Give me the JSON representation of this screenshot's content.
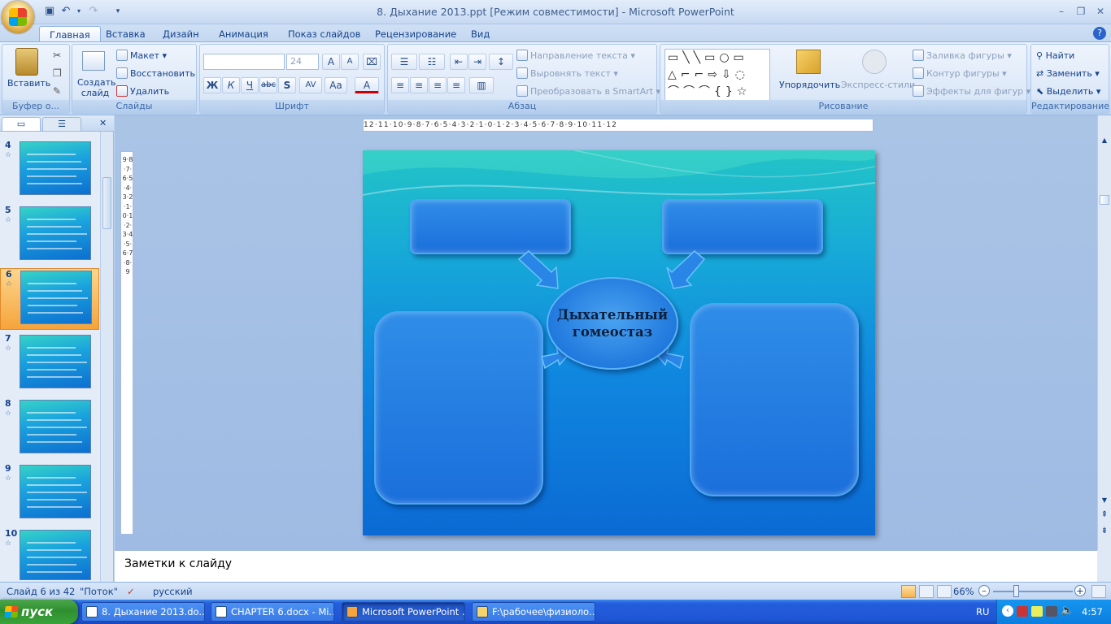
{
  "window": {
    "title": "8. Дыхание 2013.ppt [Режим совместимости] - Microsoft PowerPoint"
  },
  "tabs": [
    "Главная",
    "Вставка",
    "Дизайн",
    "Анимация",
    "Показ слайдов",
    "Рецензирование",
    "Вид"
  ],
  "ribbon": {
    "clipboard": {
      "paste": "Вставить",
      "label": "Буфер о..."
    },
    "slides": {
      "new_slide": "Создать слайд",
      "layout": "Макет",
      "reset": "Восстановить",
      "delete": "Удалить",
      "label": "Слайды"
    },
    "font": {
      "size": "24",
      "label": "Шрифт",
      "bold": "Ж",
      "italic": "К",
      "underline": "Ч",
      "strike": "abc",
      "shadow": "S",
      "spacing": "AV",
      "case": "Aa",
      "color": "A"
    },
    "paragraph": {
      "text_direction": "Направление текста",
      "align_text": "Выровнять текст",
      "smartart": "Преобразовать в SmartArt",
      "label": "Абзац"
    },
    "drawing": {
      "arrange": "Упорядочить",
      "quick_styles": "Экспресс-стили",
      "fill": "Заливка фигуры",
      "outline": "Контур фигуры",
      "effects": "Эффекты для фигур",
      "label": "Рисование"
    },
    "editing": {
      "find": "Найти",
      "replace": "Заменить",
      "select": "Выделить",
      "label": "Редактирование"
    }
  },
  "thumbnails": [
    {
      "num": "4",
      "selected": false
    },
    {
      "num": "5",
      "selected": false
    },
    {
      "num": "6",
      "selected": true
    },
    {
      "num": "7",
      "selected": false
    },
    {
      "num": "8",
      "selected": false
    },
    {
      "num": "9",
      "selected": false
    },
    {
      "num": "10",
      "selected": false
    }
  ],
  "ruler": {
    "horizontal": "12·11·10·9·8·7·6·5·4·3·2·1·0·1·2·3·4·5·6·7·8·9·10·11·12",
    "vertical": "9·8·7·6·5·4·3·2·1·0·1·2·3·4·5·6·7·8·9"
  },
  "slide": {
    "center_text_line1": "Дыхательный",
    "center_text_line2": "гомеостаз"
  },
  "notes": {
    "placeholder": "Заметки к слайду"
  },
  "status": {
    "slide_info": "Слайд 6 из 42",
    "theme": "\"Поток\"",
    "language": "русский",
    "zoom": "66%"
  },
  "taskbar": {
    "start": "пуск",
    "tasks": [
      "8. Дыхание 2013.do...",
      "CHAPTER 6.docx - Mi...",
      "Microsoft PowerPoint ...",
      "F:\\рабочее\\физиоло..."
    ],
    "lang": "RU",
    "time": "4:57"
  },
  "colors": {
    "slide_top": "#23c4c7",
    "slide_bottom": "#0b6ad4",
    "selected_thumb": "#f6a43b",
    "taskbar": "#245edc"
  }
}
